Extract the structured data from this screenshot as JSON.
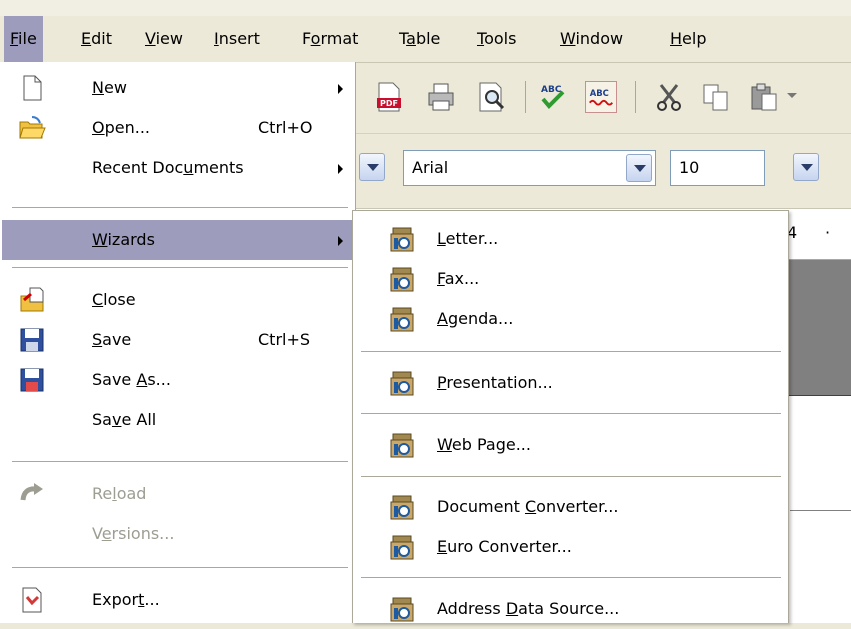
{
  "menubar": {
    "items": [
      {
        "id": "file",
        "pre": "",
        "u": "F",
        "post": "ile",
        "active": true
      },
      {
        "id": "edit",
        "pre": "",
        "u": "E",
        "post": "dit"
      },
      {
        "id": "view",
        "pre": "",
        "u": "V",
        "post": "iew"
      },
      {
        "id": "insert",
        "pre": "",
        "u": "I",
        "post": "nsert"
      },
      {
        "id": "format",
        "pre": "F",
        "u": "o",
        "post": "rmat"
      },
      {
        "id": "table",
        "pre": "T",
        "u": "a",
        "post": "ble"
      },
      {
        "id": "tools",
        "pre": "",
        "u": "T",
        "post": "ools"
      },
      {
        "id": "window",
        "pre": "",
        "u": "W",
        "post": "indow"
      },
      {
        "id": "help",
        "pre": "",
        "u": "H",
        "post": "elp"
      }
    ]
  },
  "file_menu": {
    "items": [
      {
        "id": "new",
        "pre": "",
        "u": "N",
        "post": "ew",
        "icon": "new-document-icon",
        "submenu": true
      },
      {
        "id": "open",
        "pre": "",
        "u": "O",
        "post": "pen...",
        "shortcut": "Ctrl+O",
        "icon": "open-folder-icon"
      },
      {
        "id": "recent-documents",
        "pre": "Recent Doc",
        "u": "u",
        "post": "ments",
        "submenu": true
      },
      {
        "id": "wizards",
        "pre": "",
        "u": "W",
        "post": "izards",
        "submenu": true,
        "highlighted": true
      },
      {
        "id": "close",
        "pre": "",
        "u": "C",
        "post": "lose",
        "icon": "close-document-icon"
      },
      {
        "id": "save",
        "pre": "",
        "u": "S",
        "post": "ave",
        "shortcut": "Ctrl+S",
        "icon": "save-icon"
      },
      {
        "id": "save-as",
        "pre": "Save ",
        "u": "A",
        "post": "s...",
        "icon": "save-as-icon"
      },
      {
        "id": "save-all",
        "pre": "Sa",
        "u": "v",
        "post": "e All"
      },
      {
        "id": "reload",
        "pre": "Re",
        "u": "l",
        "post": "oad",
        "icon": "reload-icon",
        "disabled": true
      },
      {
        "id": "versions",
        "pre": "V",
        "u": "e",
        "post": "rsions...",
        "disabled": true
      },
      {
        "id": "export",
        "pre": "Expor",
        "u": "t",
        "post": "...",
        "icon": "export-icon"
      }
    ]
  },
  "wizards_submenu": {
    "items": [
      {
        "id": "letter",
        "pre": "",
        "u": "L",
        "post": "etter..."
      },
      {
        "id": "fax",
        "pre": "",
        "u": "F",
        "post": "ax..."
      },
      {
        "id": "agenda",
        "pre": "",
        "u": "A",
        "post": "genda..."
      },
      {
        "id": "presentation",
        "pre": "",
        "u": "P",
        "post": "resentation..."
      },
      {
        "id": "web-page",
        "pre": "",
        "u": "W",
        "post": "eb Page..."
      },
      {
        "id": "document-converter",
        "pre": "Document ",
        "u": "C",
        "post": "onverter..."
      },
      {
        "id": "euro-converter",
        "pre": "",
        "u": "E",
        "post": "uro Converter..."
      },
      {
        "id": "address-data-source",
        "pre": "Address ",
        "u": "D",
        "post": "ata Source..."
      }
    ],
    "icon": "wizard-icon"
  },
  "toolbar": {
    "icons": [
      "export-pdf-icon",
      "print-icon",
      "page-preview-icon",
      "spellcheck-icon",
      "autospellcheck-icon",
      "cut-icon",
      "copy-icon",
      "paste-icon"
    ]
  },
  "format_bar": {
    "font_name": "Arial",
    "font_size": "10"
  },
  "ruler": {
    "number": "4",
    "dot": "·"
  }
}
